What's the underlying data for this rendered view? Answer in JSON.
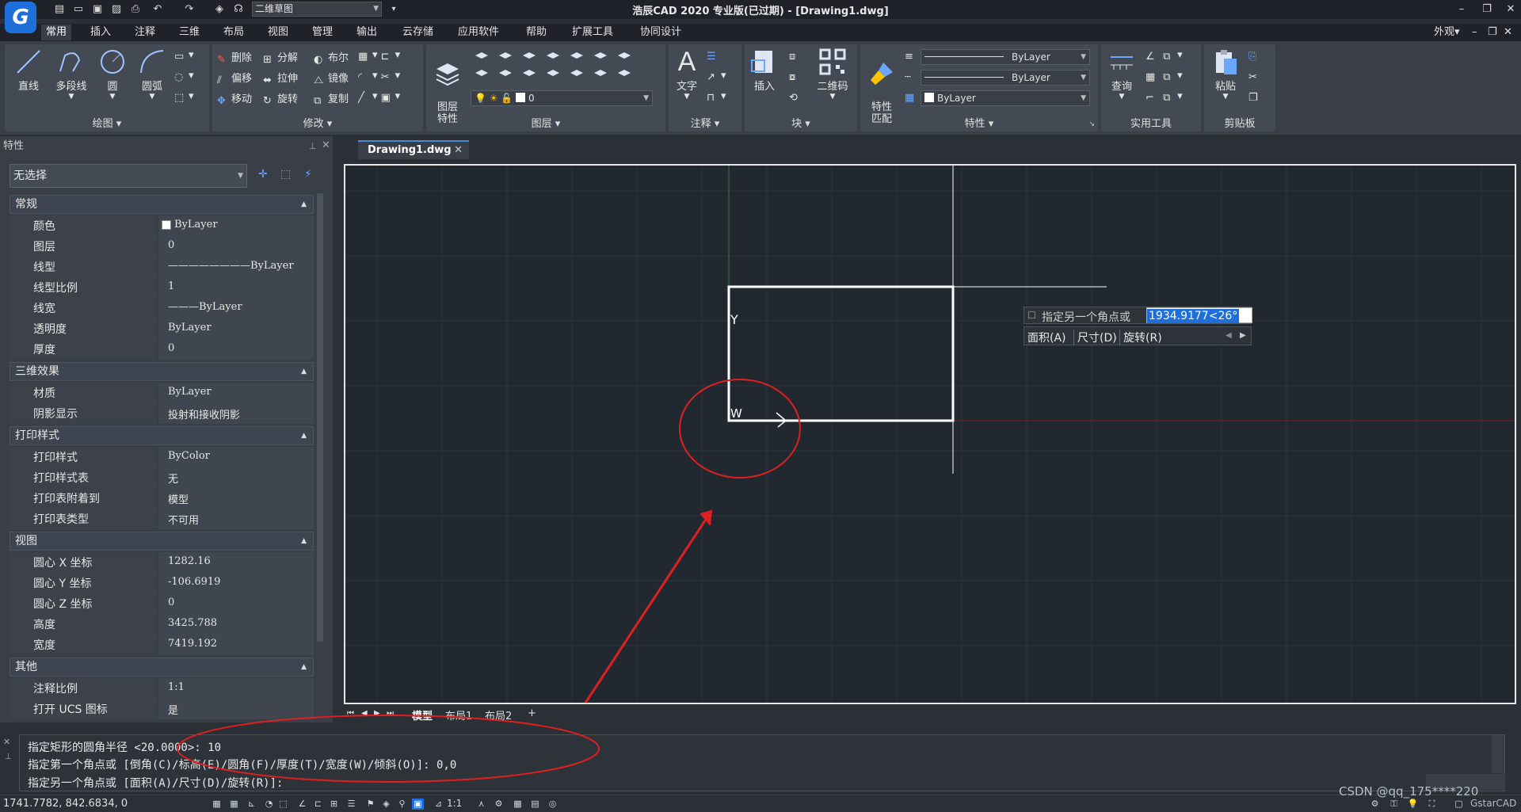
{
  "window": {
    "title": "浩辰CAD 2020 专业版(已过期) - [Drawing1.dwg]",
    "workspace": "二维草图",
    "appearance": "外观"
  },
  "menu_tabs": [
    "常用",
    "插入",
    "注释",
    "三维",
    "布局",
    "视图",
    "管理",
    "输出",
    "云存储",
    "应用软件",
    "帮助",
    "扩展工具",
    "协同设计"
  ],
  "ribbon": {
    "draw": {
      "title": "绘图",
      "line": "直线",
      "polyline": "多段线",
      "circle": "圆",
      "arc": "圆弧"
    },
    "modify": {
      "title": "修改",
      "erase": "删除",
      "explode": "分解",
      "boolean": "布尔",
      "offset": "偏移",
      "stretch": "拉伸",
      "mirror": "镜像",
      "move": "移动",
      "rotate": "旋转",
      "copy": "复制"
    },
    "layer": {
      "title": "图层",
      "props": "图层\n特性",
      "current": "0"
    },
    "annotation": {
      "title": "注释",
      "text": "文字"
    },
    "block": {
      "title": "块",
      "insert": "插入",
      "qrcode": "二维码"
    },
    "properties": {
      "title": "特性",
      "match": "特性\n匹配",
      "line1": "ByLayer",
      "line2": "ByLayer",
      "color": "ByLayer"
    },
    "utilities": {
      "title": "实用工具",
      "query": "查询"
    },
    "clipboard": {
      "title": "剪贴板",
      "paste": "粘贴"
    }
  },
  "properties_panel": {
    "title": "特性",
    "selection": "无选择",
    "sections": [
      {
        "name": "常规",
        "rows": [
          {
            "k": "颜色",
            "v": "ByLayer"
          },
          {
            "k": "图层",
            "v": "0"
          },
          {
            "k": "线型",
            "v": "————————ByLayer"
          },
          {
            "k": "线型比例",
            "v": "1"
          },
          {
            "k": "线宽",
            "v": "———ByLayer"
          },
          {
            "k": "透明度",
            "v": "ByLayer"
          },
          {
            "k": "厚度",
            "v": "0"
          }
        ]
      },
      {
        "name": "三维效果",
        "rows": [
          {
            "k": "材质",
            "v": "ByLayer"
          },
          {
            "k": "阴影显示",
            "v": "投射和接收阴影"
          }
        ]
      },
      {
        "name": "打印样式",
        "rows": [
          {
            "k": "打印样式",
            "v": "ByColor"
          },
          {
            "k": "打印样式表",
            "v": "无"
          },
          {
            "k": "打印表附着到",
            "v": "模型"
          },
          {
            "k": "打印表类型",
            "v": "不可用"
          }
        ]
      },
      {
        "name": "视图",
        "rows": [
          {
            "k": "圆心 X 坐标",
            "v": "1282.16"
          },
          {
            "k": "圆心 Y 坐标",
            "v": "-106.6919"
          },
          {
            "k": "圆心 Z 坐标",
            "v": "0"
          },
          {
            "k": "高度",
            "v": "3425.788"
          },
          {
            "k": "宽度",
            "v": "7419.192"
          }
        ]
      },
      {
        "name": "其他",
        "rows": [
          {
            "k": "注释比例",
            "v": "1:1"
          },
          {
            "k": "打开 UCS 图标",
            "v": "是"
          }
        ]
      }
    ]
  },
  "document_tab": "Drawing1.dwg",
  "layout_tabs": [
    "模型",
    "布局1",
    "布局2",
    "+"
  ],
  "dynamic_input": {
    "prompt": "指定另一个角点或",
    "value": "1934.9177<26°",
    "options": [
      "面积(A)",
      "尺寸(D)",
      "旋转(R)"
    ]
  },
  "ucs_labels": {
    "y": "Y",
    "w": "W"
  },
  "command_lines": [
    "指定矩形的圆角半径 <20.0000>: 10",
    "指定第一个角点或 [倒角(C)/标高(E)/圆角(F)/厚度(T)/宽度(W)/倾斜(O)]: 0,0",
    "指定另一个角点或 [面积(A)/尺寸(D)/旋转(R)]:"
  ],
  "status": {
    "coords": "1741.7782, 842.6834, 0",
    "scale": "1:1",
    "brand": "GstarCAD"
  },
  "watermark": "CSDN @qq_175****220",
  "colors": {
    "accent": "#1e6fd9",
    "annotation_red": "#e02020",
    "canvas": "#212830"
  }
}
